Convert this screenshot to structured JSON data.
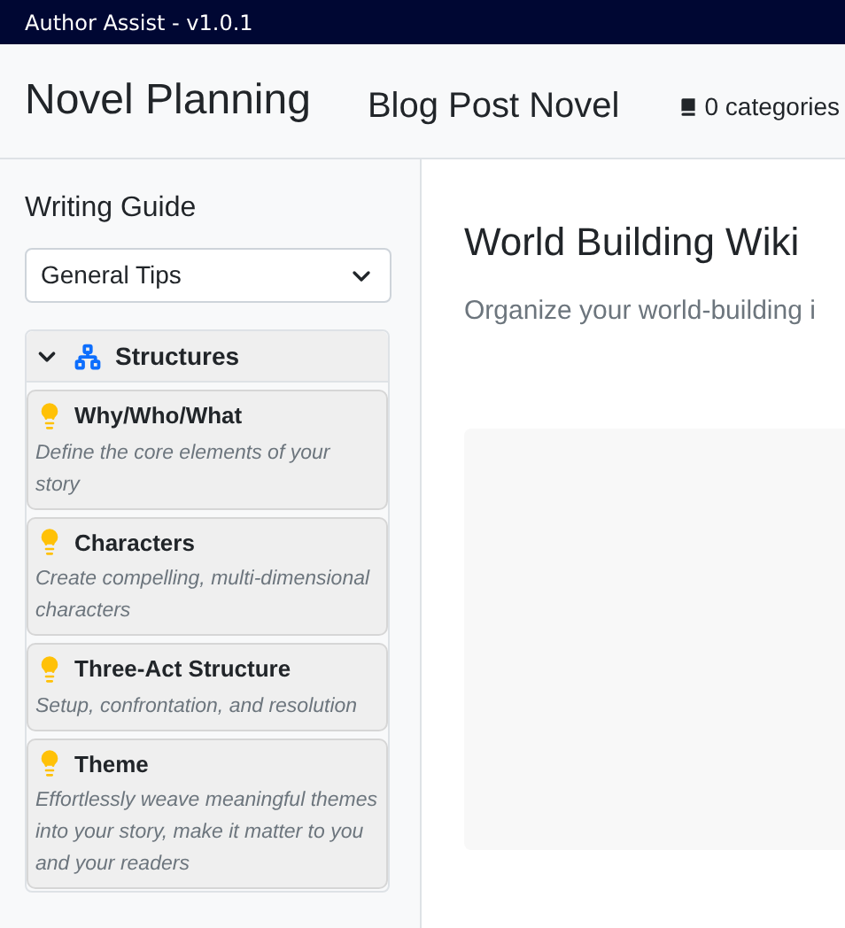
{
  "window": {
    "title": "Author Assist - v1.0.1"
  },
  "header": {
    "title": "Novel Planning",
    "project": "Blog Post Novel",
    "categories": "0 categories"
  },
  "sidebar": {
    "title": "Writing Guide",
    "dropdown": {
      "value": "General Tips"
    },
    "section": {
      "label": "Structures",
      "expanded": true,
      "items": [
        {
          "title": "Why/Who/What",
          "description": "Define the core elements of your story"
        },
        {
          "title": "Characters",
          "description": "Create compelling, multi-dimensional characters"
        },
        {
          "title": "Three-Act Structure",
          "description": "Setup, confrontation, and resolution"
        },
        {
          "title": "Theme",
          "description": "Effortlessly weave meaningful themes into your story, make it matter to you and your readers"
        }
      ]
    }
  },
  "main": {
    "title": "World Building Wiki",
    "subtitle": "Organize your world-building i"
  }
}
